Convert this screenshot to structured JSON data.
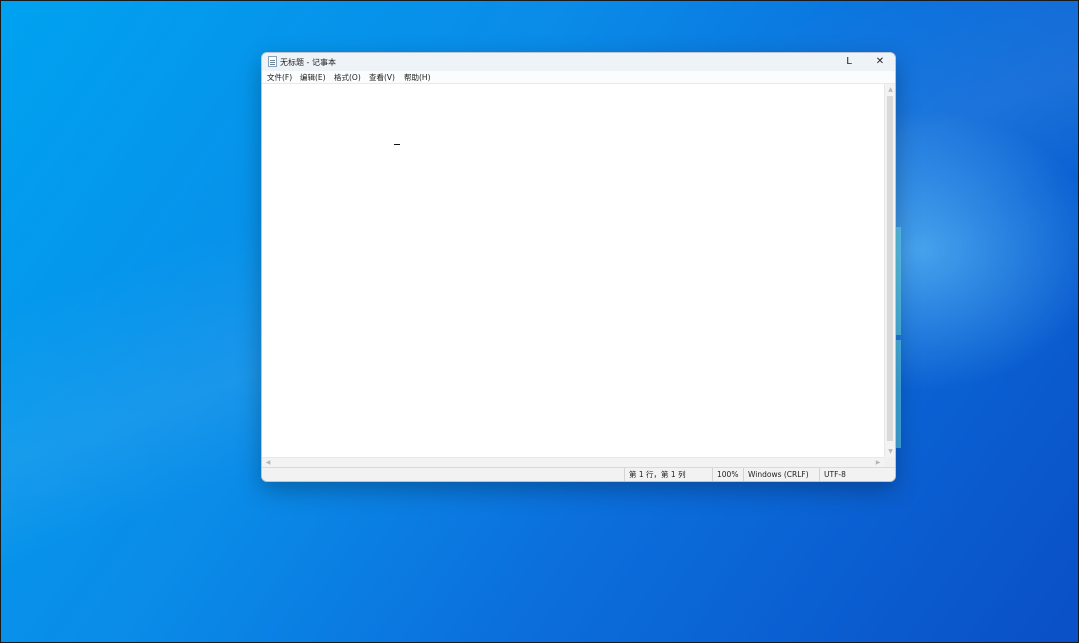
{
  "window": {
    "title": "无标题 - 记事本",
    "minimize_glyph": "L",
    "close_glyph": "✕"
  },
  "menu": {
    "items": [
      {
        "label": "文件(F)"
      },
      {
        "label": "编辑(E)"
      },
      {
        "label": "格式(O)"
      },
      {
        "label": "查看(V)"
      },
      {
        "label": "帮助(H)"
      }
    ]
  },
  "editor": {
    "content": ""
  },
  "statusbar": {
    "position": "第 1 行，第 1 列",
    "zoom": "100%",
    "line_ending": "Windows (CRLF)",
    "encoding": "UTF-8"
  },
  "scrollbar": {
    "up": "▲",
    "down": "▼",
    "left": "◀",
    "right": "▶"
  },
  "colors": {
    "desktop_accent": "#0a8be8",
    "window_bg": "#ffffff",
    "titlebar_bg": "#eef3f8"
  }
}
